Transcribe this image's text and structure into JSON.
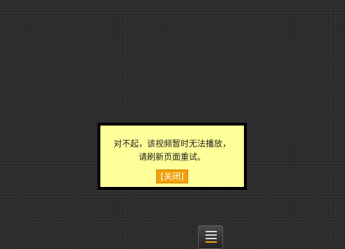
{
  "dialog": {
    "message_line1": "对不起，该视频暂时无法播放，",
    "message_line2": "请刷新页面重试。",
    "close_label": "[关闭]"
  },
  "controls": {
    "menu_icon": "menu-icon"
  },
  "colors": {
    "dialog_background": "#ffff99",
    "dialog_border": "#000000",
    "close_button": "#f0a00b",
    "page_background": "#2b2b2b"
  }
}
